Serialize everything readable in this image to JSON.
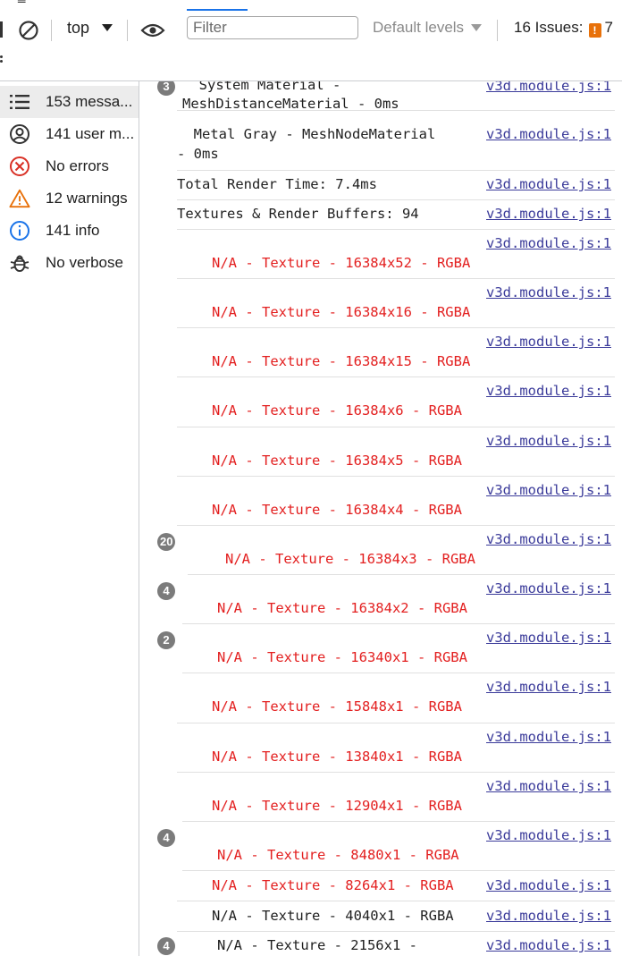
{
  "toolbar": {
    "context_label": "top",
    "filter_placeholder": "Filter",
    "levels_label": "Default levels",
    "issues_label": "16 Issues:",
    "issues_count": "7"
  },
  "sidebar": {
    "items": [
      {
        "label": "153 messa..."
      },
      {
        "label": "141 user m..."
      },
      {
        "label": "No errors"
      },
      {
        "label": "12 warnings"
      },
      {
        "label": "141 info"
      },
      {
        "label": "No verbose"
      }
    ]
  },
  "console": {
    "source": "v3d.module.js:1",
    "rows": [
      {
        "badge": "3",
        "line1": "  System Material -",
        "line2": "MeshDistanceMaterial - 0ms"
      },
      {
        "line1": "  Metal Gray - MeshNodeMaterial",
        "line2": "- 0ms"
      },
      {
        "line1": "Total Render Time: 7.4ms"
      },
      {
        "line1": "Textures & Render Buffers: 94"
      },
      {
        "msg": "N/A - Texture - 16384x52 - RGBA"
      },
      {
        "msg": "N/A - Texture - 16384x16 - RGBA"
      },
      {
        "msg": "N/A - Texture - 16384x15 - RGBA"
      },
      {
        "msg": "N/A - Texture - 16384x6 - RGBA"
      },
      {
        "msg": "N/A - Texture - 16384x5 - RGBA"
      },
      {
        "msg": "N/A - Texture - 16384x4 - RGBA"
      },
      {
        "badge": "20",
        "msg": "N/A - Texture - 16384x3 - RGBA"
      },
      {
        "badge": "4",
        "msg": "N/A - Texture - 16384x2 - RGBA"
      },
      {
        "badge": "2",
        "msg": "N/A - Texture - 16340x1 - RGBA"
      },
      {
        "msg": "N/A - Texture - 15848x1 - RGBA"
      },
      {
        "msg": "N/A - Texture - 13840x1 - RGBA"
      },
      {
        "msg": "N/A - Texture - 12904x1 - RGBA"
      },
      {
        "badge": "4",
        "msg": "N/A - Texture - 8480x1 - RGBA"
      },
      {
        "msg": "N/A - Texture - 8264x1 - RGBA"
      },
      {
        "msg": "N/A - Texture - 4040x1 - RGBA"
      },
      {
        "badge": "4",
        "msg": "N/A - Texture - 2156x1 -"
      }
    ]
  },
  "colors": {
    "error_text": "#e32020",
    "link": "#3b3b9a",
    "warning": "#e8710a",
    "info": "#1a73e8",
    "error_icon": "#d93025"
  }
}
